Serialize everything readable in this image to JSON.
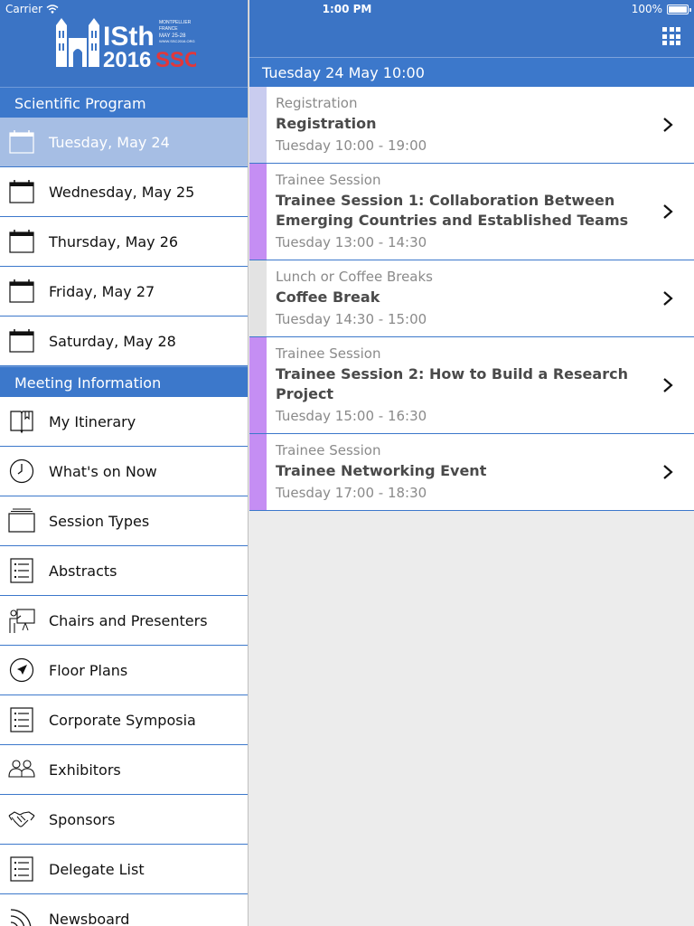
{
  "status_bar": {
    "carrier": "Carrier",
    "time": "1:00 PM",
    "battery": "100%"
  },
  "logo": {
    "main": "ISth",
    "sub": "2016",
    "ssc": "SSC",
    "city": "MONTPELLIER",
    "country": "FRANCE",
    "dates": "MAY 25-28",
    "site": "WWW.SSC2016.ORG"
  },
  "sidebar": {
    "section_program": "Scientific Program",
    "days": [
      {
        "label": "Tuesday, May 24",
        "icon": "calendar-icon"
      },
      {
        "label": "Wednesday, May 25",
        "icon": "calendar-icon"
      },
      {
        "label": "Thursday, May 26",
        "icon": "calendar-icon"
      },
      {
        "label": "Friday, May 27",
        "icon": "calendar-icon"
      },
      {
        "label": "Saturday, May 28",
        "icon": "calendar-icon"
      }
    ],
    "section_meeting": "Meeting Information",
    "items": [
      {
        "label": "My Itinerary",
        "icon": "book-icon"
      },
      {
        "label": "What's on Now",
        "icon": "clock-icon"
      },
      {
        "label": "Session Types",
        "icon": "stack-icon"
      },
      {
        "label": "Abstracts",
        "icon": "list-icon"
      },
      {
        "label": "Chairs and Presenters",
        "icon": "presenter-icon"
      },
      {
        "label": "Floor Plans",
        "icon": "compass-icon"
      },
      {
        "label": "Corporate Symposia",
        "icon": "list-icon"
      },
      {
        "label": "Exhibitors",
        "icon": "people-icon"
      },
      {
        "label": "Sponsors",
        "icon": "handshake-icon"
      },
      {
        "label": "Delegate List",
        "icon": "list-icon"
      },
      {
        "label": "Newsboard",
        "icon": "rss-icon"
      }
    ]
  },
  "main": {
    "date_header": "Tuesday 24 May 10:00",
    "sessions": [
      {
        "type": "Registration",
        "title": "Registration",
        "time": "Tuesday 10:00 - 19:00",
        "color": "#c9ccef"
      },
      {
        "type": "Trainee Session",
        "title": "Trainee Session 1: Collaboration Between Emerging Countries and Established Teams",
        "time": "Tuesday 13:00 - 14:30",
        "color": "#c58ef3"
      },
      {
        "type": "Lunch or Coffee Breaks",
        "title": "Coffee Break",
        "time": "Tuesday 14:30 - 15:00",
        "color": "#e3e3e3"
      },
      {
        "type": "Trainee Session",
        "title": "Trainee Session 2: How to Build a Research Project",
        "time": "Tuesday 15:00 - 16:30",
        "color": "#c58ef3"
      },
      {
        "type": "Trainee Session",
        "title": "Trainee Networking Event",
        "time": "Tuesday 17:00 - 18:30",
        "color": "#c58ef3"
      }
    ]
  },
  "colors": {
    "header_blue": "#3b74c5",
    "active_item": "#a6bee4",
    "logo_red": "#e2373a"
  }
}
